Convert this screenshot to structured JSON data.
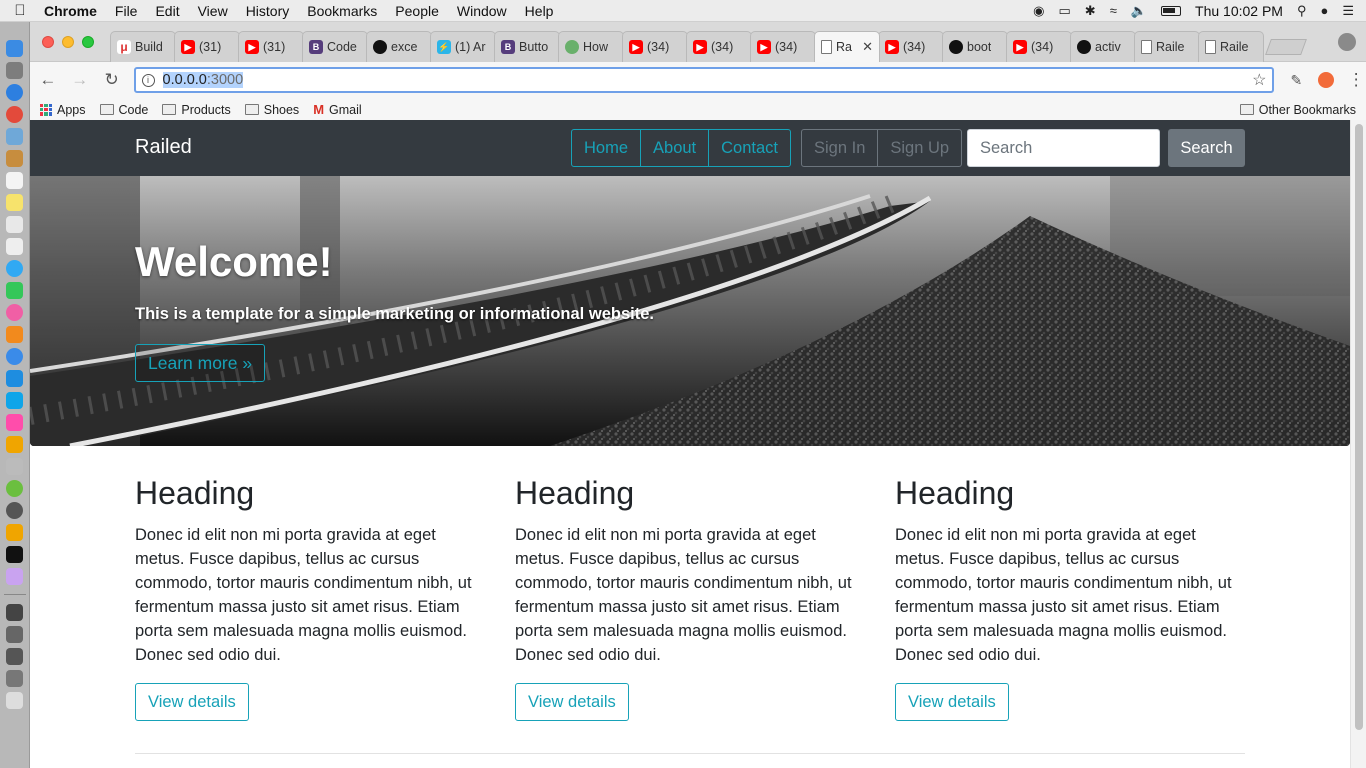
{
  "menubar": {
    "app_name": "Chrome",
    "items": [
      "File",
      "Edit",
      "View",
      "History",
      "Bookmarks",
      "People",
      "Window",
      "Help"
    ],
    "clock": "Thu 10:02 PM"
  },
  "browser": {
    "tabs": [
      {
        "title": "Build",
        "icon": "code-icon"
      },
      {
        "title": "(31)",
        "icon": "youtube-icon"
      },
      {
        "title": "(31)",
        "icon": "youtube-icon"
      },
      {
        "title": "Code",
        "icon": "bootstrap-icon"
      },
      {
        "title": "exce",
        "icon": "github-icon"
      },
      {
        "title": "(1) Ar",
        "icon": "bolt-icon"
      },
      {
        "title": "Butto",
        "icon": "bootstrap-icon"
      },
      {
        "title": "How",
        "icon": "hexagon-icon"
      },
      {
        "title": "(34)",
        "icon": "youtube-icon"
      },
      {
        "title": "(34)",
        "icon": "youtube-icon"
      },
      {
        "title": "(34)",
        "icon": "youtube-icon"
      },
      {
        "title": "Ra",
        "icon": "document-icon",
        "active": true
      },
      {
        "title": "(34)",
        "icon": "youtube-icon"
      },
      {
        "title": "boot",
        "icon": "github-icon"
      },
      {
        "title": "(34)",
        "icon": "youtube-icon"
      },
      {
        "title": "activ",
        "icon": "github-icon"
      },
      {
        "title": "Raile",
        "icon": "document-icon"
      },
      {
        "title": "Raile",
        "icon": "document-icon"
      }
    ],
    "url_host": "0.0.0.0",
    "url_port": ":3000",
    "bookmarks": {
      "apps": "Apps",
      "code": "Code",
      "products": "Products",
      "shoes": "Shoes",
      "gmail": "Gmail",
      "other": "Other Bookmarks"
    }
  },
  "site": {
    "brand": "Railed",
    "nav": [
      "Home",
      "About",
      "Contact"
    ],
    "auth": [
      "Sign In",
      "Sign Up"
    ],
    "search_placeholder": "Search",
    "search_button": "Search",
    "hero": {
      "title": "Welcome!",
      "subtitle": "This is a template for a simple marketing or informational website.",
      "button": "Learn more »"
    },
    "columns": [
      {
        "heading": "Heading",
        "body": "Donec id elit non mi porta gravida at eget metus. Fusce dapibus, tellus ac cursus commodo, tortor mauris condimentum nibh, ut fermentum massa justo sit amet risus. Etiam porta sem malesuada magna mollis euismod. Donec sed odio dui.",
        "button": "View details"
      },
      {
        "heading": "Heading",
        "body": "Donec id elit non mi porta gravida at eget metus. Fusce dapibus, tellus ac cursus commodo, tortor mauris condimentum nibh, ut fermentum massa justo sit amet risus. Etiam porta sem malesuada magna mollis euismod. Donec sed odio dui.",
        "button": "View details"
      },
      {
        "heading": "Heading",
        "body": "Donec id elit non mi porta gravida at eget metus. Fusce dapibus, tellus ac cursus commodo, tortor mauris condimentum nibh, ut fermentum massa justo sit amet risus. Etiam porta sem malesuada magna mollis euismod. Donec sed odio dui.",
        "button": "View details"
      }
    ]
  },
  "colors": {
    "navbar_bg": "#343a40",
    "accent": "#17a2b8",
    "secondary": "#6c757d"
  }
}
